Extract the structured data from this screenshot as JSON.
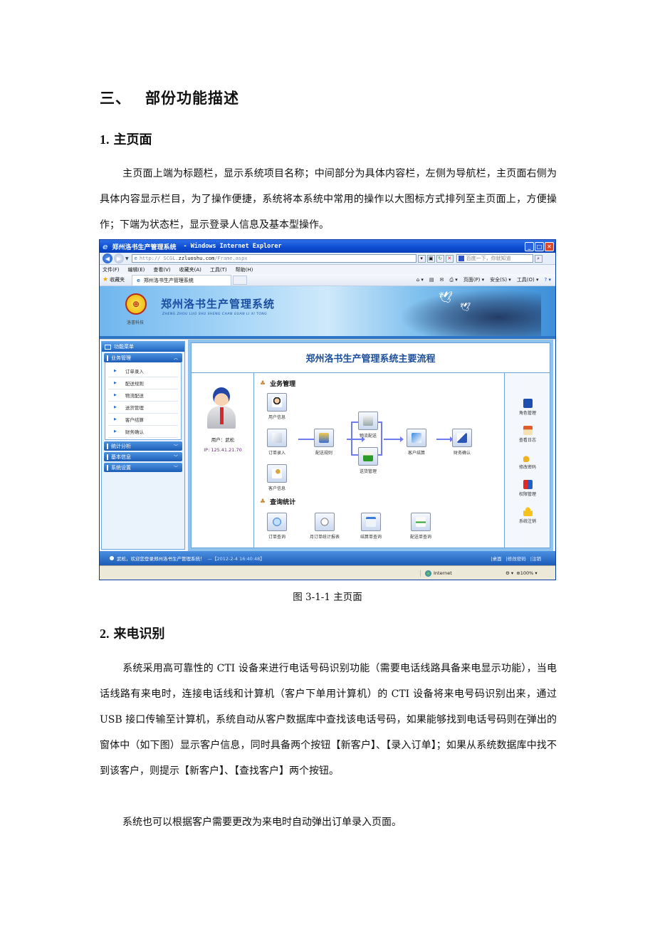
{
  "section": {
    "number": "三、",
    "title": "部份功能描述"
  },
  "sub1": {
    "number": "1.",
    "title": "主页面"
  },
  "para1": "主页面上端为标题栏，显示系统项目名称；中间部分为具体内容栏，左侧为导航栏，主页面右侧为具体内容显示栏目，为了操作便捷，系统将本系统中常用的操作以大图标方式排列至主页面上，方便操作；下端为状态栏，显示登录人信息及基本型操作。",
  "figure": {
    "caption": "图 3-1-1  主页面",
    "browser": {
      "window_title": "郑州洛书生产管理系统",
      "window_suffix": "- Windows Internet Explorer",
      "url_prefix": "http:// SCGL.",
      "url_domain": "zzluoshu.com",
      "url_path": "/Frame.aspx",
      "search_placeholder": "百度一下，你就知道",
      "menu": [
        "文件(F)",
        "编辑(E)",
        "查看(V)",
        "收藏夹(A)",
        "工具(T)",
        "帮助(H)"
      ],
      "favorites_label": "收藏夹",
      "tab_label": "郑州洛书生产管理系统",
      "command_bar": [
        "页面(P) ▾",
        "安全(S) ▾",
        "工具(O) ▾",
        "? ▾"
      ],
      "status_zone": "Internet",
      "status_zoom": "100%"
    },
    "app": {
      "logo_caption": "洛書科技",
      "title": "郑州洛书生产管理系统",
      "title_pinyin": "ZHENG ZHOU LUO SHU SHENG CHAN GUAN LI XI TONG",
      "sidebar": {
        "header": "功能菜单",
        "groups": [
          {
            "label": "业务管理",
            "expanded": true,
            "items": [
              "订单录入",
              "配送规则",
              "物流配送",
              "送货管理",
              "客户结算",
              "财务确认"
            ]
          },
          {
            "label": "统计分析",
            "expanded": false
          },
          {
            "label": "基本信息",
            "expanded": false
          },
          {
            "label": "系统设置",
            "expanded": false
          }
        ]
      },
      "flow_title": "郑州洛书生产管理系统主要流程",
      "user": {
        "name": "用户：武松",
        "ip": "IP: 125.41.21.70"
      },
      "business_section": "业务管理",
      "business_nodes": {
        "user_info": "用户信息",
        "order_entry": "订单录入",
        "delivery_rule": "配送规则",
        "logistics": "物流配送",
        "delivery_mgmt": "送货管理",
        "settlement": "客户结算",
        "finance": "财务确认",
        "customer_info": "客户信息"
      },
      "query_section": "查询统计",
      "query_nodes": [
        "订单查询",
        "月订单统计报表",
        "结算单查询",
        "配送单查询"
      ],
      "right_actions": [
        "角色管理",
        "查看日志",
        "修改密码",
        "权限管理",
        "系统注销"
      ],
      "status_welcome": "武松，欢迎您登录郑州洛书生产管理系统！",
      "status_time": "—【2012-2-4 16:40:48】",
      "status_links": [
        "|桌面",
        "|修改密码",
        "|注销"
      ]
    }
  },
  "sub2": {
    "number": "2.",
    "title": "来电识别"
  },
  "para2": "系统采用高可靠性的 CTI 设备来进行电话号码识别功能（需要电话线路具备来电显示功能），当电话线路有来电时，连接电话线和计算机（客户下单用计算机）的 CTI 设备将来电号码识别出来，通过 USB 接口传输至计算机，系统自动从客户数据库中查找该电话号码，如果能够找到电话号码则在弹出的窗体中（如下图）显示客户信息，同时具备两个按钮【新客户】、【录入订单】；如果从系统数据库中找不到该客户，则提示【新客户】、【查找客户】两个按钮。",
  "para3": "系统也可以根据客户需要更改为来电时自动弹出订单录入页面。"
}
